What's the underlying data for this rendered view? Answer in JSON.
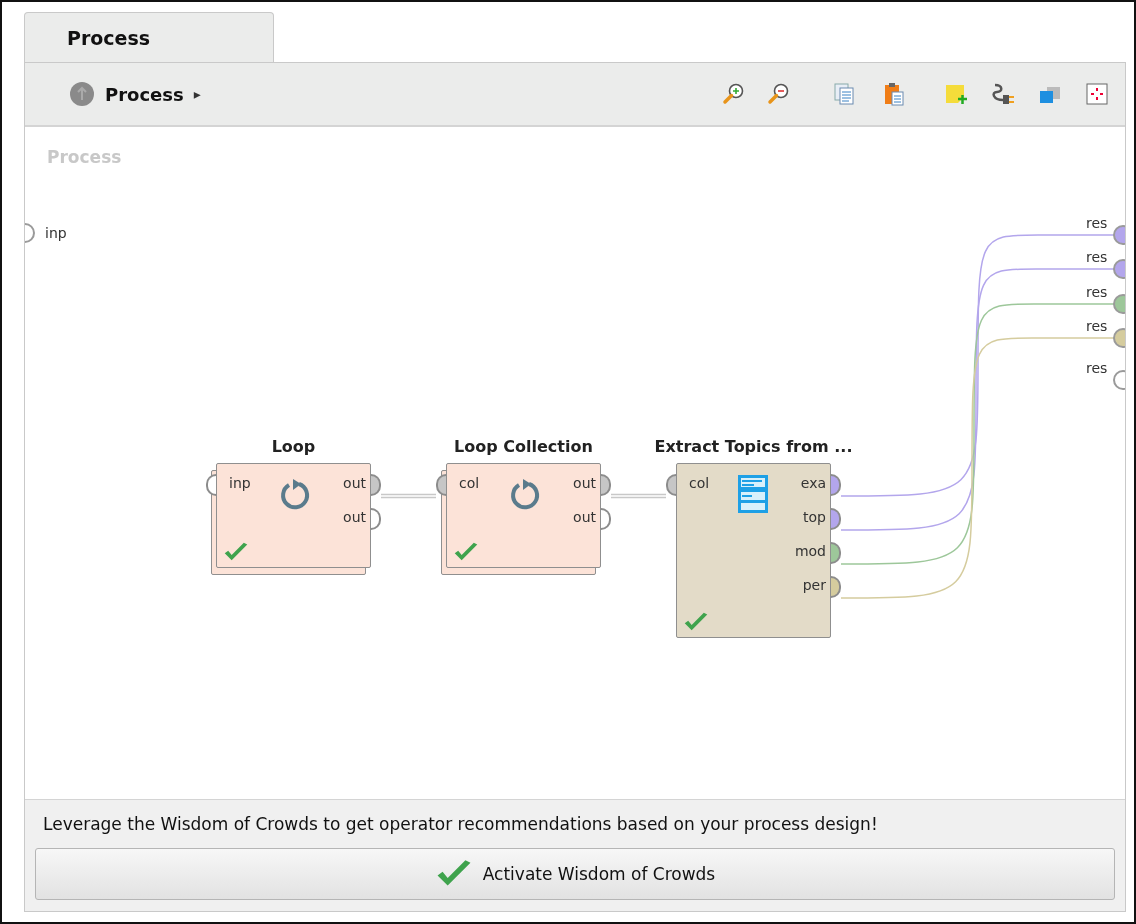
{
  "tab": {
    "label": "Process",
    "selected": true
  },
  "breadcrumb": {
    "label": "Process",
    "arrow": "▸"
  },
  "canvas": {
    "title": "Process",
    "input_ports": [
      {
        "label": "inp",
        "connected": false
      }
    ],
    "operators": [
      {
        "name": "Loop",
        "kind": "loop",
        "stacked": true,
        "ok": true,
        "inputs": [
          {
            "label": "inp",
            "connected": false
          }
        ],
        "outputs": [
          {
            "label": "out",
            "connected": true,
            "color": "#c6c6c6"
          },
          {
            "label": "out",
            "connected": false
          }
        ]
      },
      {
        "name": "Loop Collection",
        "kind": "loop",
        "stacked": true,
        "ok": true,
        "inputs": [
          {
            "label": "col",
            "connected": true,
            "color": "#c6c6c6"
          }
        ],
        "outputs": [
          {
            "label": "out",
            "connected": true,
            "color": "#c6c6c6"
          },
          {
            "label": "out",
            "connected": false
          }
        ]
      },
      {
        "name": "Extract Topics from ...",
        "kind": "text",
        "stacked": false,
        "ok": true,
        "inputs": [
          {
            "label": "col",
            "connected": true,
            "color": "#c6c6c6"
          }
        ],
        "outputs": [
          {
            "label": "exa",
            "connected": true,
            "color": "#b3a6ec"
          },
          {
            "label": "top",
            "connected": true,
            "color": "#b3a6ec"
          },
          {
            "label": "mod",
            "connected": true,
            "color": "#9dc79a"
          },
          {
            "label": "per",
            "connected": true,
            "color": "#d5cc9e"
          }
        ]
      }
    ],
    "result_ports": [
      {
        "label": "res",
        "connected": true,
        "color": "#b3a6ec"
      },
      {
        "label": "res",
        "connected": true,
        "color": "#b3a6ec"
      },
      {
        "label": "res",
        "connected": true,
        "color": "#9dc79a"
      },
      {
        "label": "res",
        "connected": true,
        "color": "#d5cc9e"
      },
      {
        "label": "res",
        "connected": false
      }
    ]
  },
  "recommendation": {
    "text": "Leverage the Wisdom of Crowds to get operator recommendations based on your process design!",
    "button": "Activate Wisdom of Crowds"
  }
}
